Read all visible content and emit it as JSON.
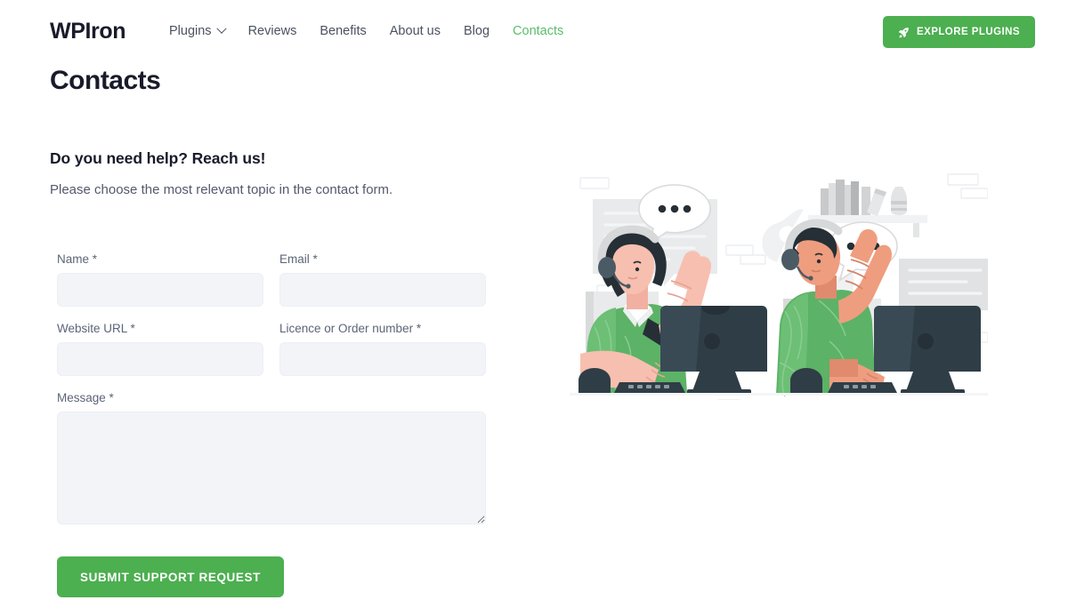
{
  "header": {
    "brand": "WPIron",
    "nav": [
      {
        "label": "Plugins",
        "icon": "chevron-down-icon",
        "has_dropdown": true,
        "active": false
      },
      {
        "label": "Reviews",
        "has_dropdown": false,
        "active": false
      },
      {
        "label": "Benefits",
        "has_dropdown": false,
        "active": false
      },
      {
        "label": "About us",
        "has_dropdown": false,
        "active": false
      },
      {
        "label": "Blog",
        "has_dropdown": false,
        "active": false
      },
      {
        "label": "Contacts",
        "has_dropdown": false,
        "active": true
      }
    ],
    "cta": {
      "label": "EXPLORE PLUGINS",
      "icon": "rocket-icon"
    }
  },
  "page": {
    "title": "Contacts",
    "section_heading": "Do you need help? Reach us!",
    "section_subtitle": "Please choose the most relevant topic in the contact form."
  },
  "form": {
    "fields": [
      {
        "label": "Name *",
        "value": "",
        "placeholder": ""
      },
      {
        "label": "Email *",
        "value": "",
        "placeholder": ""
      },
      {
        "label": "Website URL *",
        "value": "",
        "placeholder": ""
      },
      {
        "label": "Licence or Order number *",
        "value": "",
        "placeholder": ""
      },
      {
        "label": "Message *",
        "value": "",
        "placeholder": ""
      }
    ],
    "submit_label": "SUBMIT SUPPORT REQUEST"
  },
  "illustration": {
    "name": "customer-support-illustration",
    "description": "Two support agents wearing headsets at computers with speech bubbles"
  },
  "colors": {
    "accent_green": "#4caf50",
    "nav_active_green": "#5bbd6d",
    "text_dark": "#181b2a",
    "text_muted": "#525a6d",
    "field_bg": "#f2f4f8",
    "page_bg": "#ffffff"
  }
}
